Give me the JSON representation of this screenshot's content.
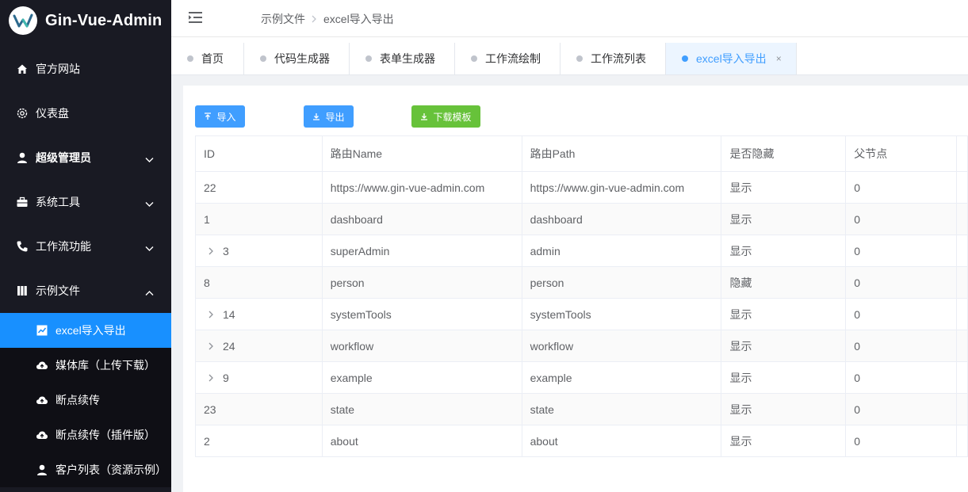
{
  "app": {
    "title": "Gin-Vue-Admin"
  },
  "sidebar": {
    "items": [
      {
        "label": "官方网站",
        "icon": "home-icon"
      },
      {
        "label": "仪表盘",
        "icon": "gear-icon"
      },
      {
        "label": "超级管理员",
        "icon": "user-icon"
      },
      {
        "label": "系统工具",
        "icon": "toolbox-icon"
      },
      {
        "label": "工作流功能",
        "icon": "phone-icon"
      },
      {
        "label": "示例文件",
        "icon": "folder-icon"
      }
    ],
    "sub_items": [
      {
        "label": "excel导入导出",
        "icon": "chart-icon"
      },
      {
        "label": "媒体库（上传下载）",
        "icon": "cloud-upload-icon"
      },
      {
        "label": "断点续传",
        "icon": "cloud-upload-icon"
      },
      {
        "label": "断点续传（插件版）",
        "icon": "cloud-upload-icon"
      },
      {
        "label": "客户列表（资源示例）",
        "icon": "user-icon"
      }
    ]
  },
  "breadcrumb": {
    "parent": "示例文件",
    "current": "excel导入导出"
  },
  "tabs": [
    {
      "label": "首页"
    },
    {
      "label": "代码生成器"
    },
    {
      "label": "表单生成器"
    },
    {
      "label": "工作流绘制"
    },
    {
      "label": "工作流列表"
    },
    {
      "label": "excel导入导出",
      "close": "×"
    }
  ],
  "toolbar": {
    "import_label": "导入",
    "export_label": "导出",
    "template_label": "下载模板"
  },
  "table": {
    "headers": [
      "ID",
      "路由Name",
      "路由Path",
      "是否隐藏",
      "父节点"
    ],
    "rows": [
      {
        "id": "22",
        "name": "https://www.gin-vue-admin.com",
        "path": "https://www.gin-vue-admin.com",
        "hidden": "显示",
        "parent": "0",
        "expandable": false
      },
      {
        "id": "1",
        "name": "dashboard",
        "path": "dashboard",
        "hidden": "显示",
        "parent": "0",
        "expandable": false
      },
      {
        "id": "3",
        "name": "superAdmin",
        "path": "admin",
        "hidden": "显示",
        "parent": "0",
        "expandable": true
      },
      {
        "id": "8",
        "name": "person",
        "path": "person",
        "hidden": "隐藏",
        "parent": "0",
        "expandable": false
      },
      {
        "id": "14",
        "name": "systemTools",
        "path": "systemTools",
        "hidden": "显示",
        "parent": "0",
        "expandable": true
      },
      {
        "id": "24",
        "name": "workflow",
        "path": "workflow",
        "hidden": "显示",
        "parent": "0",
        "expandable": true
      },
      {
        "id": "9",
        "name": "example",
        "path": "example",
        "hidden": "显示",
        "parent": "0",
        "expandable": true
      },
      {
        "id": "23",
        "name": "state",
        "path": "state",
        "hidden": "显示",
        "parent": "0",
        "expandable": false
      },
      {
        "id": "2",
        "name": "about",
        "path": "about",
        "hidden": "显示",
        "parent": "0",
        "expandable": false
      }
    ]
  },
  "colors": {
    "sidebar_bg": "#191a23",
    "active": "#1890ff",
    "primary": "#409eff",
    "success": "#67c23a"
  }
}
